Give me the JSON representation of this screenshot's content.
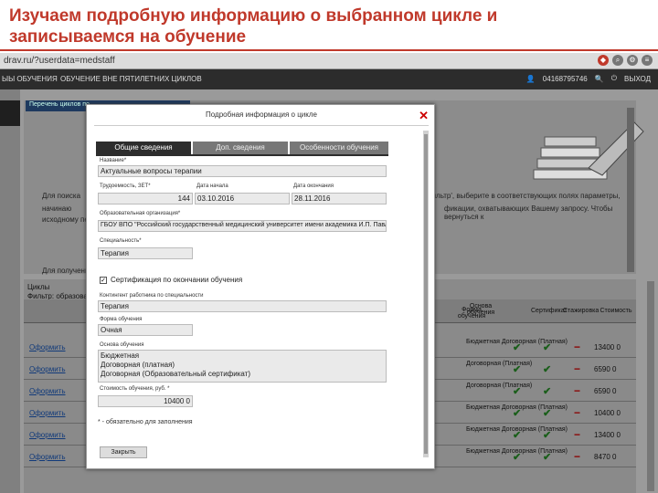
{
  "slide": {
    "title": "Изучаем подробную информацию о выбранном цикле и записываемся на обучение"
  },
  "browser": {
    "address": "drav.ru/?userdata=medstaff"
  },
  "navbar": {
    "item1": "ЫЫ ОБУЧЕНИЯ",
    "item2": "ОБУЧЕНИЕ ВНЕ ПЯТИЛЕТНИХ ЦИКЛОВ",
    "phone": "04168795746",
    "exit": "ВЫХОД"
  },
  "background": {
    "panel_header": "Перечень циклов по",
    "text1": "Для поиска",
    "text2": "фильтр', выберите в соответствующих полях параметры,",
    "text3": "начинаю",
    "text4": "фикации, охватывающих Вашему запросу. Чтобы вернуться к",
    "text5": "исходному пер",
    "text6": "Для получения",
    "cycles_label": "Циклы",
    "filter_label": "Фильтр: образовательного"
  },
  "table": {
    "headers": [
      "Форма обучения",
      "Основа обучения",
      "Сертификат",
      "Стажировка",
      "Стоимость"
    ],
    "open_label": "Оформить",
    "rows": [
      {
        "basis": "Бюджетная Договорная (Платная)",
        "price": "13400 0"
      },
      {
        "basis": "Договорная (Платная)",
        "price": "6590 0"
      },
      {
        "basis": "Договорная (Платная)",
        "price": "6590 0"
      },
      {
        "basis": "Бюджетная Договорная (Платная)",
        "price": "10400 0"
      },
      {
        "basis": "Бюджетная Договорная (Платная)",
        "price": "13400 0"
      },
      {
        "basis": "Бюджетная Договорная (Платная)",
        "price": "8470 0"
      }
    ]
  },
  "modal": {
    "title": "Подробная информация о цикле",
    "close_icon": "✕",
    "tabs": [
      "Общие сведения",
      "Доп. сведения",
      "Особенности обучения"
    ],
    "fields": {
      "name_label": "Название*",
      "name_value": "Актуальные вопросы терапии",
      "duration_label": "Трудоемкость, ЗЕТ*",
      "duration_value": "144",
      "start_label": "Дата начала",
      "start_value": "03.10.2016",
      "end_label": "Дата окончания",
      "end_value": "28.11.2016",
      "org_label": "Образовательная организация*",
      "org_value": "ГБОУ ВПО \"Российский государственный медицинский университет имени академика И.П. Павл",
      "spec_label": "Специальность*",
      "spec_value": "Терапия",
      "cert_label": "Сертификация по окончании обучения",
      "contingent_label": "Контингент работника по специальности",
      "contingent_value": "Терапия",
      "form_label": "Форма обучения",
      "form_value": "Очная",
      "basis_label": "Основа обучения",
      "basis_values": [
        "Бюджетная",
        "Договорная (платная)",
        "Договорная (Образовательный сертификат)"
      ],
      "price_label": "Стоимость обучения, руб. *",
      "price_value": "10400 0"
    },
    "required_note": "* - обязательно для заполнения",
    "close_button": "Закрыть"
  }
}
